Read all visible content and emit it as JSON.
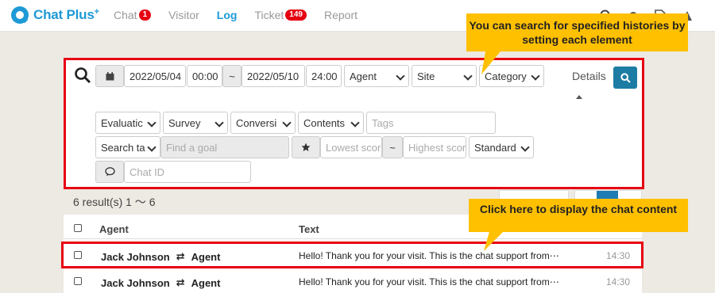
{
  "app": {
    "logo_text": "Chat Plus",
    "logo_sup": "+"
  },
  "nav": [
    {
      "label": "Chat",
      "badge": "1"
    },
    {
      "label": "Visitor",
      "badge": null
    },
    {
      "label": "Log",
      "badge": null,
      "active": true
    },
    {
      "label": "Ticket",
      "badge": "149"
    },
    {
      "label": "Report",
      "badge": null
    }
  ],
  "search": {
    "start_date": "2022/05/04",
    "start_time": "00:00",
    "range_sep": "~",
    "end_date": "2022/05/10",
    "end_time": "24:00",
    "agent": "Agent",
    "site": "Site",
    "category": "Category",
    "details_label": "Details",
    "evaluation": "Evaluatic",
    "survey": "Survey",
    "conversion": "Conversi",
    "contents": "Contents",
    "tags_placeholder": "Tags",
    "search_target": "Search ta",
    "goal_placeholder": "Find a goal",
    "lowest_score_placeholder": "Lowest score",
    "highest_score_placeholder": "Highest score",
    "score_mode": "Standard",
    "chat_id_placeholder": "Chat ID"
  },
  "results": {
    "summary": "6 result(s) 1 ～ 6"
  },
  "table": {
    "headers": {
      "agent": "Agent",
      "text": "Text"
    },
    "rows": [
      {
        "visitor": "Jack Johnson",
        "agent": "Agent",
        "text": "Hello! Thank you for your visit. This is the chat support from⋯",
        "time": "14:30"
      },
      {
        "visitor": "Jack Johnson",
        "agent": "Agent",
        "text": "Hello! Thank you for your visit. This is the chat support from⋯",
        "time": "14:30"
      }
    ]
  },
  "callouts": {
    "search_tip": "You can search for specified histories by setting each element",
    "row_tip": "Click here to display the chat content"
  },
  "colors": {
    "accent": "#1e9ad6",
    "highlight": "#e60012",
    "callout": "#ffc000",
    "search_button": "#1d7ca3"
  },
  "icons": [
    "search-icon",
    "settings-icon",
    "document-icon",
    "warning-icon",
    "calendar-icon",
    "star-icon",
    "chat-bubble-icon",
    "swap-arrows-icon"
  ]
}
